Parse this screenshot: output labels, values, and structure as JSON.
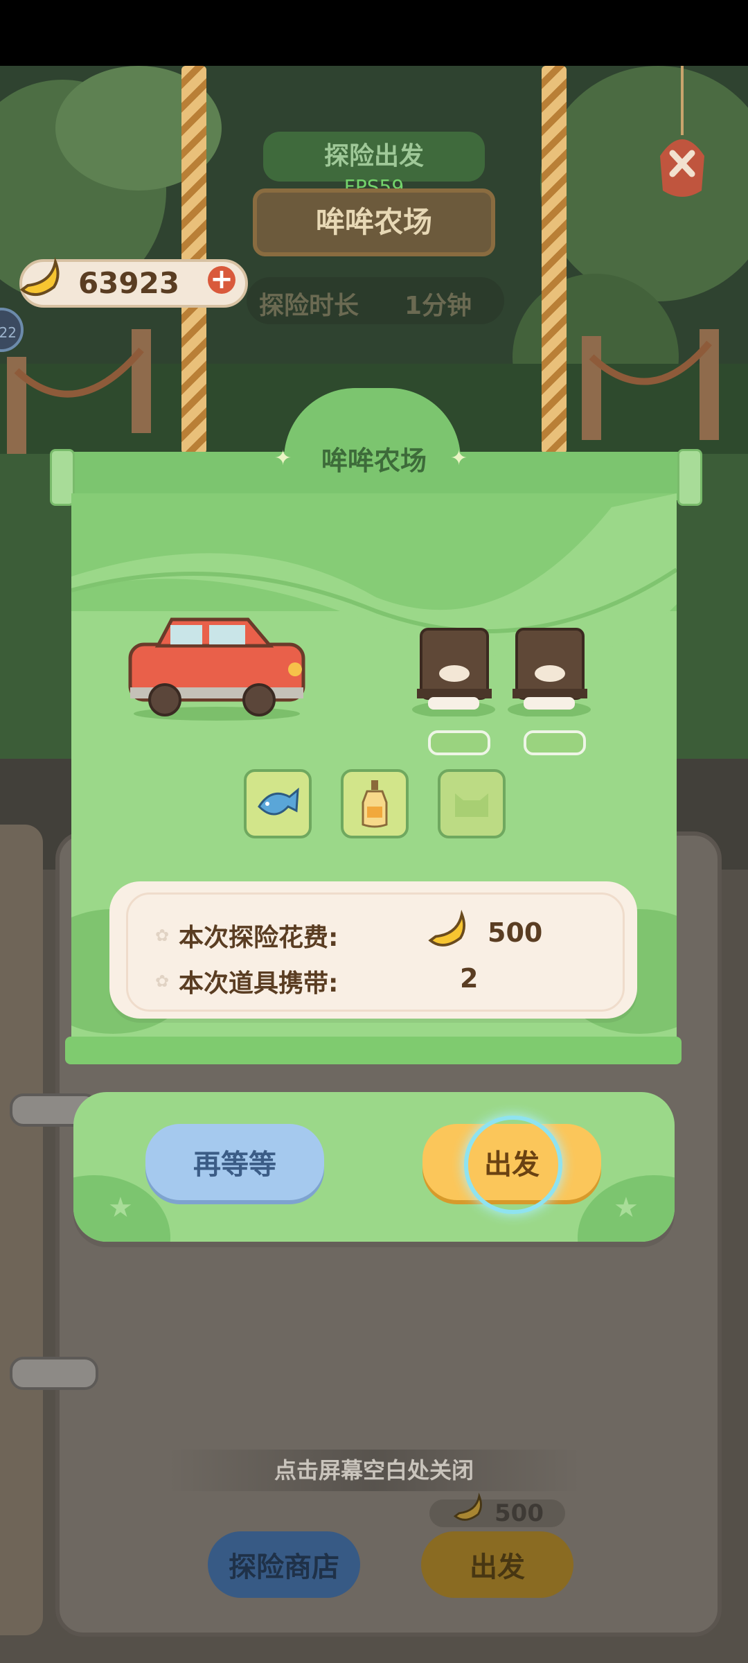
{
  "header": {
    "banana_count": "63923",
    "sign_title": "探险出发",
    "fps": "FPS59",
    "farm_name": "哞哞农场",
    "duration_label": "探险时长",
    "duration_value": "1分钟",
    "side_badge": "22"
  },
  "modal": {
    "title": "哞哞农场",
    "cost_label": "本次探险花费:",
    "cost_value": "500",
    "items_label": "本次道具携带:",
    "items_value": "2",
    "wait_button": "再等等",
    "go_button": "出发"
  },
  "footer": {
    "close_hint": "点击屏幕空白处关闭",
    "cost_value": "500",
    "shop_button": "探险商店",
    "go_button": "出发"
  },
  "colors": {
    "panel_green": "#9bd889",
    "title_green": "#7cc56f",
    "blue_button": "#a5c9ee",
    "yellow_button": "#fbc65a",
    "text_brown": "#5a3d22"
  }
}
